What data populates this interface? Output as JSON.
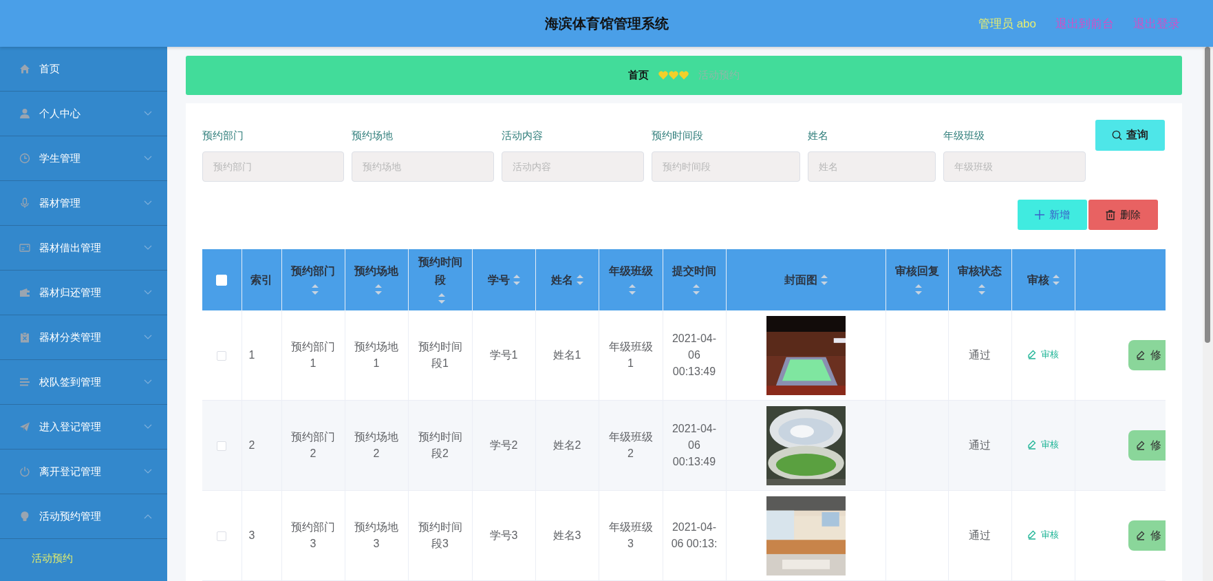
{
  "header": {
    "title": "海滨体育馆管理系统",
    "user": "管理员 abo",
    "links": [
      "退出到前台",
      "退出登录"
    ]
  },
  "sidebar": {
    "items": [
      {
        "label": "首页"
      },
      {
        "label": "个人中心",
        "expanded": false
      },
      {
        "label": "学生管理",
        "expanded": false
      },
      {
        "label": "器材管理",
        "expanded": false
      },
      {
        "label": "器材借出管理",
        "expanded": false
      },
      {
        "label": "器材归还管理",
        "expanded": false
      },
      {
        "label": "器材分类管理",
        "expanded": false
      },
      {
        "label": "校队签到管理",
        "expanded": false
      },
      {
        "label": "进入登记管理",
        "expanded": false
      },
      {
        "label": "离开登记管理",
        "expanded": false
      },
      {
        "label": "活动预约管理",
        "expanded": true,
        "children": [
          {
            "label": "活动预约",
            "selected": true
          }
        ]
      }
    ]
  },
  "breadcrumb": {
    "items": [
      "首页",
      "活动预约"
    ]
  },
  "search": {
    "fields": [
      {
        "label": "预约部门",
        "placeholder": "预约部门"
      },
      {
        "label": "预约场地",
        "placeholder": "预约场地"
      },
      {
        "label": "活动内容",
        "placeholder": "活动内容"
      },
      {
        "label": "预约时间段",
        "placeholder": "预约时间段"
      },
      {
        "label": "姓名",
        "placeholder": "姓名"
      },
      {
        "label": "年级班级",
        "placeholder": "年级班级"
      }
    ],
    "button": "查询"
  },
  "actions": [
    {
      "label": "新增",
      "kind": "add"
    },
    {
      "label": "删除",
      "kind": "delete"
    }
  ],
  "table": {
    "select_all_checked": false,
    "columns": [
      {
        "label": "索引",
        "sortable": false
      },
      {
        "label": "预约部门",
        "sortable": true
      },
      {
        "label": "预约场地",
        "sortable": true
      },
      {
        "label": "预约时间段",
        "sortable": true
      },
      {
        "label": "学号",
        "sortable": true
      },
      {
        "label": "姓名",
        "sortable": true
      },
      {
        "label": "年级班级",
        "sortable": true
      },
      {
        "label": "提交时间",
        "sortable": true
      },
      {
        "label": "封面图",
        "sortable": true
      },
      {
        "label": "审核回复",
        "sortable": true
      },
      {
        "label": "审核状态",
        "sortable": true
      },
      {
        "label": "审核",
        "sortable": true
      }
    ],
    "rows": [
      {
        "checked": false,
        "index": "1",
        "department": "预约部门1",
        "venue": "预约场地1",
        "time_slot": "预约时间段1",
        "student_id": "学号1",
        "name": "姓名1",
        "class": "年级班级1",
        "submitted": "2021-04-06 00:13:49",
        "status": "通过",
        "review_link": "审核",
        "edit_button": "修"
      },
      {
        "checked": false,
        "index": "2",
        "department": "预约部门2",
        "venue": "预约场地2",
        "time_slot": "预约时间段2",
        "student_id": "学号2",
        "name": "姓名2",
        "class": "年级班级2",
        "submitted": "2021-04-06 00:13:49",
        "status": "通过",
        "review_link": "审核",
        "edit_button": "修"
      },
      {
        "checked": false,
        "index": "3",
        "department": "预约部门3",
        "venue": "预约场地3",
        "time_slot": "预约时间段3",
        "student_id": "学号3",
        "name": "姓名3",
        "class": "年级班级3",
        "submitted": "2021-04-06 00:13:",
        "status": "通过",
        "review_link": "审核",
        "edit_button": "修"
      }
    ]
  }
}
